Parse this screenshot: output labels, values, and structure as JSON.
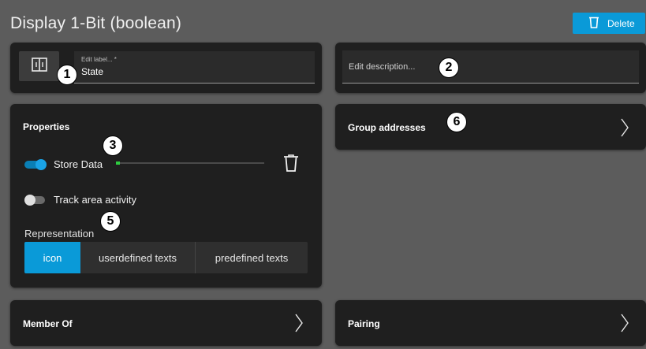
{
  "header": {
    "title": "Display 1-Bit (boolean)",
    "delete_label": "Delete"
  },
  "label_field": {
    "floating_label": "Edit label... *",
    "value": "State"
  },
  "description_field": {
    "placeholder": "Edit description..."
  },
  "properties": {
    "title": "Properties",
    "store_data_label": "Store Data",
    "store_data_on": true,
    "track_area_label": "Track area activity",
    "track_area_on": false,
    "representation_label": "Representation",
    "representation_options": [
      "icon",
      "userdefined texts",
      "predefined texts"
    ],
    "representation_selected": "icon"
  },
  "group_addresses": {
    "title": "Group addresses"
  },
  "member_of": {
    "title": "Member Of"
  },
  "pairing": {
    "title": "Pairing"
  },
  "callouts": [
    "1",
    "2",
    "3",
    "5",
    "6"
  ],
  "colors": {
    "accent": "#0a9ad8",
    "background": "#5c5c5c",
    "card": "#1f1f1f",
    "progress_green": "#2ecc40"
  }
}
